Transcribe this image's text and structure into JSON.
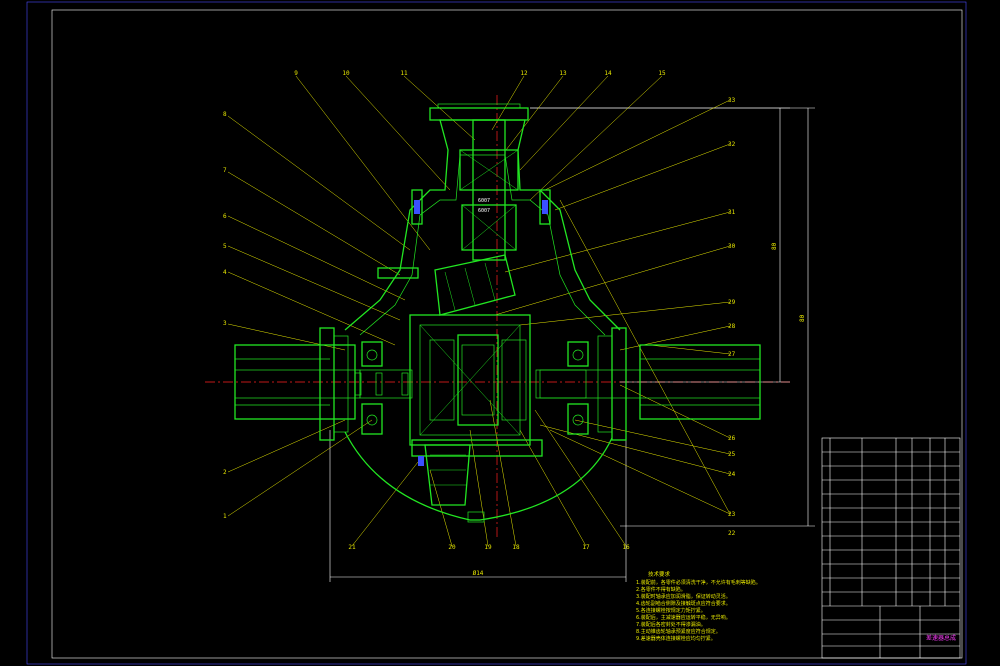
{
  "drawing": {
    "title_label": "差速器总成",
    "dimensions": {
      "height_upper": "80",
      "height_total": "80",
      "width_bottom": "Ø14"
    },
    "bearing_marks": [
      "6007",
      "6007"
    ],
    "notes": {
      "heading": "技术要求",
      "lines": [
        "1.装配前，各零件必须清洗干净，不允许有毛刺等缺陷。",
        "2.各零件不得有缺陷。",
        "3.装配时轴承应加润滑脂，保证转动灵活。",
        "4.齿轮副啮合侧隙及接触斑点应符合要求。",
        "5.各连接螺栓按规定力矩拧紧。",
        "6.装配后，主减速器应运转平稳，无异响。",
        "7.装配后各密封处不得渗漏油。",
        "8.主动锥齿轮轴承预紧度应符合规定。",
        "9.差速器壳体连接螺栓应均匀拧紧。"
      ]
    },
    "callouts_top": [
      "9",
      "10",
      "11",
      "12",
      "13",
      "14",
      "15"
    ],
    "callouts_left": [
      "8",
      "7",
      "6",
      "5",
      "4",
      "3",
      "2",
      "1"
    ],
    "callouts_right": [
      "33",
      "32",
      "31",
      "30",
      "29",
      "28",
      "27",
      "26",
      "25",
      "24",
      "23",
      "22"
    ],
    "callouts_bottom": [
      "21",
      "20",
      "19",
      "18",
      "17",
      "16"
    ]
  }
}
